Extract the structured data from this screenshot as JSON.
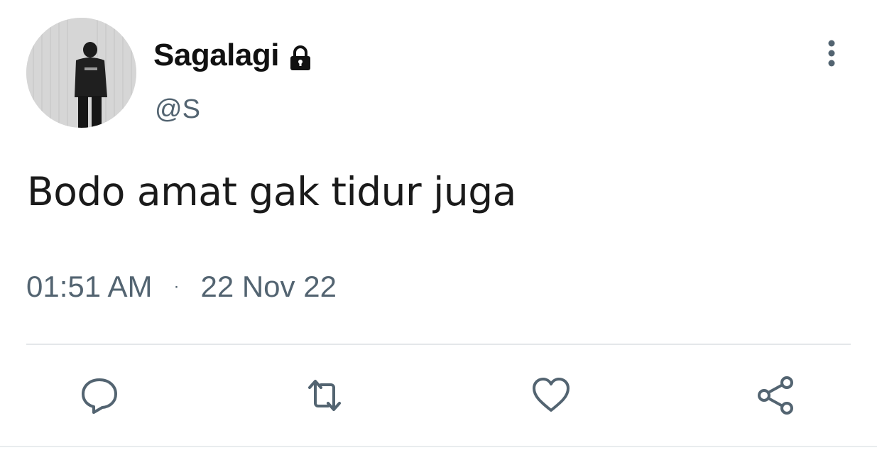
{
  "author": {
    "display_name": "Sagalagi",
    "handle": "@S",
    "avatar_icon": "user-avatar-photo",
    "verified_icon": "lock-icon"
  },
  "tweet": {
    "text": "Bodo amat gak tidur juga",
    "time": "01:51 AM",
    "separator": "·",
    "date": "22 Nov 22"
  },
  "actions": [
    {
      "name": "reply",
      "icon": "reply-icon"
    },
    {
      "name": "retweet",
      "icon": "retweet-icon"
    },
    {
      "name": "like",
      "icon": "heart-icon"
    },
    {
      "name": "share",
      "icon": "share-icon"
    }
  ],
  "colors": {
    "text": "#1a1a1a",
    "secondary": "#536471",
    "divider": "#e4e7ea",
    "background": "#ffffff"
  }
}
